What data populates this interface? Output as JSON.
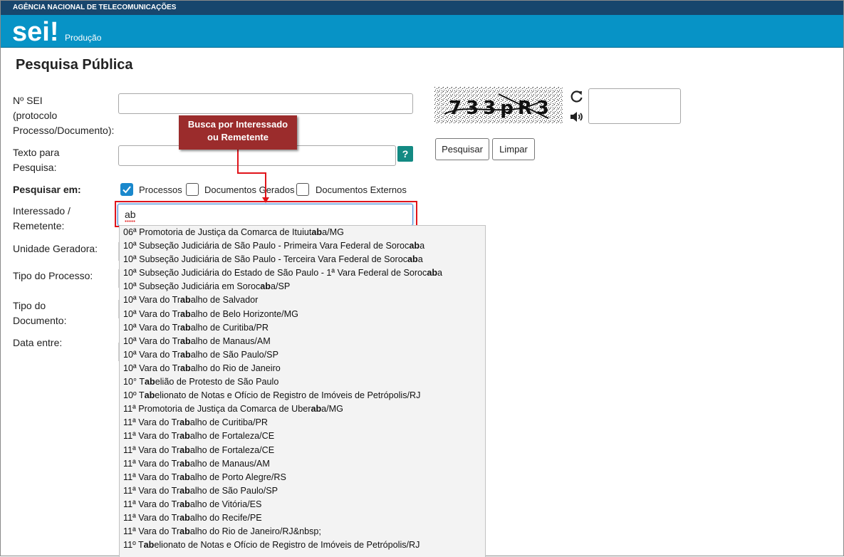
{
  "topbar": {
    "agency": "AGÊNCIA NACIONAL DE TELECOMUNICAÇÕES"
  },
  "header": {
    "logo_text": "sei!",
    "environment": "Produção"
  },
  "page": {
    "title": "Pesquisa Pública"
  },
  "form": {
    "nsei_label_line1": "Nº SEI",
    "nsei_label_line2": "(protocolo",
    "nsei_label_line3": "Processo/Documento):",
    "nsei_value": "",
    "texto_label_line1": "Texto para",
    "texto_label_line2": "Pesquisa:",
    "texto_value": "",
    "help_label": "?",
    "pesquisar_em_label": "Pesquisar em:",
    "checkboxes": [
      {
        "label": "Processos",
        "checked": true
      },
      {
        "label": "Documentos Gerados",
        "checked": false
      },
      {
        "label": "Documentos Externos",
        "checked": false
      }
    ],
    "interessado_label_line1": "Interessado /",
    "interessado_label_line2": "Remetente:",
    "interessado_value": "ab",
    "unidade_label": "Unidade Geradora:",
    "tipo_processo_label": "Tipo do Processo:",
    "tipo_documento_label_line1": "Tipo do",
    "tipo_documento_label_line2": "Documento:",
    "data_label": "Data entre:"
  },
  "callout": {
    "line1": "Busca por Interessado",
    "line2": "ou Remetente"
  },
  "captcha": {
    "text": "733pR3",
    "value": ""
  },
  "buttons": {
    "search": "Pesquisar",
    "clear": "Limpar"
  },
  "autocomplete": [
    {
      "pre": "06ª Promotoria de Justiça da Comarca de Ituiut",
      "match": "ab",
      "post": "a/MG"
    },
    {
      "pre": "10ª Subseção Judiciária de São Paulo - Primeira Vara Federal de Soroc",
      "match": "ab",
      "post": "a"
    },
    {
      "pre": "10ª Subseção Judiciária de São Paulo - Terceira Vara Federal de Soroc",
      "match": "ab",
      "post": "a"
    },
    {
      "pre": "10ª Subseção Judiciária do Estado de São Paulo - 1ª Vara Federal de Soroc",
      "match": "ab",
      "post": "a"
    },
    {
      "pre": "10ª Subseção Judiciária em Soroc",
      "match": "ab",
      "post": "a/SP"
    },
    {
      "pre": "10ª Vara do Tr",
      "match": "ab",
      "post": "alho de Salvador"
    },
    {
      "pre": "10ª Vara do Tr",
      "match": "ab",
      "post": "alho de Belo Horizonte/MG"
    },
    {
      "pre": "10ª Vara do Tr",
      "match": "ab",
      "post": "alho de Curitiba/PR"
    },
    {
      "pre": "10ª Vara do Tr",
      "match": "ab",
      "post": "alho de Manaus/AM"
    },
    {
      "pre": "10ª Vara do Tr",
      "match": "ab",
      "post": "alho de São Paulo/SP"
    },
    {
      "pre": "10ª Vara do Tr",
      "match": "ab",
      "post": "alho do Rio de Janeiro"
    },
    {
      "pre": "10° T",
      "match": "ab",
      "post": "elião de Protesto de São Paulo"
    },
    {
      "pre": "10º T",
      "match": "ab",
      "post": "elionato de Notas e Ofício de Registro de Imóveis de Petrópolis/RJ"
    },
    {
      "pre": "11ª Promotoria de Justiça da Comarca de Uber",
      "match": "ab",
      "post": "a/MG"
    },
    {
      "pre": "11ª Vara do Tr",
      "match": "ab",
      "post": "alho de Curitiba/PR"
    },
    {
      "pre": "11ª Vara do Tr",
      "match": "ab",
      "post": "alho de Fortaleza/CE"
    },
    {
      "pre": "11ª Vara do Tr",
      "match": "ab",
      "post": "alho de Fortaleza/CE"
    },
    {
      "pre": "11ª Vara do Tr",
      "match": "ab",
      "post": "alho de Manaus/AM"
    },
    {
      "pre": "11ª Vara do Tr",
      "match": "ab",
      "post": "alho de Porto Alegre/RS"
    },
    {
      "pre": "11ª Vara do Tr",
      "match": "ab",
      "post": "alho de São Paulo/SP"
    },
    {
      "pre": "11ª Vara do Tr",
      "match": "ab",
      "post": "alho de Vitória/ES"
    },
    {
      "pre": "11ª Vara do Tr",
      "match": "ab",
      "post": "alho do Recife/PE"
    },
    {
      "pre": "11ª Vara do Tr",
      "match": "ab",
      "post": "alho do Rio de Janeiro/RJ&nbsp;"
    },
    {
      "pre": "11º T",
      "match": "ab",
      "post": "elionato de Notas e Ofício de Registro de Imóveis de Petrópolis/RJ"
    }
  ],
  "colors": {
    "topbar": "#17466d",
    "header": "#0793c6",
    "callout": "#9b2c2c",
    "highlight_frame": "#e0141a",
    "help": "#138a83",
    "checkbox_on": "#1a88cc"
  },
  "icons": {
    "refresh": "refresh-icon",
    "audio": "speaker-icon",
    "check": "check-icon"
  }
}
